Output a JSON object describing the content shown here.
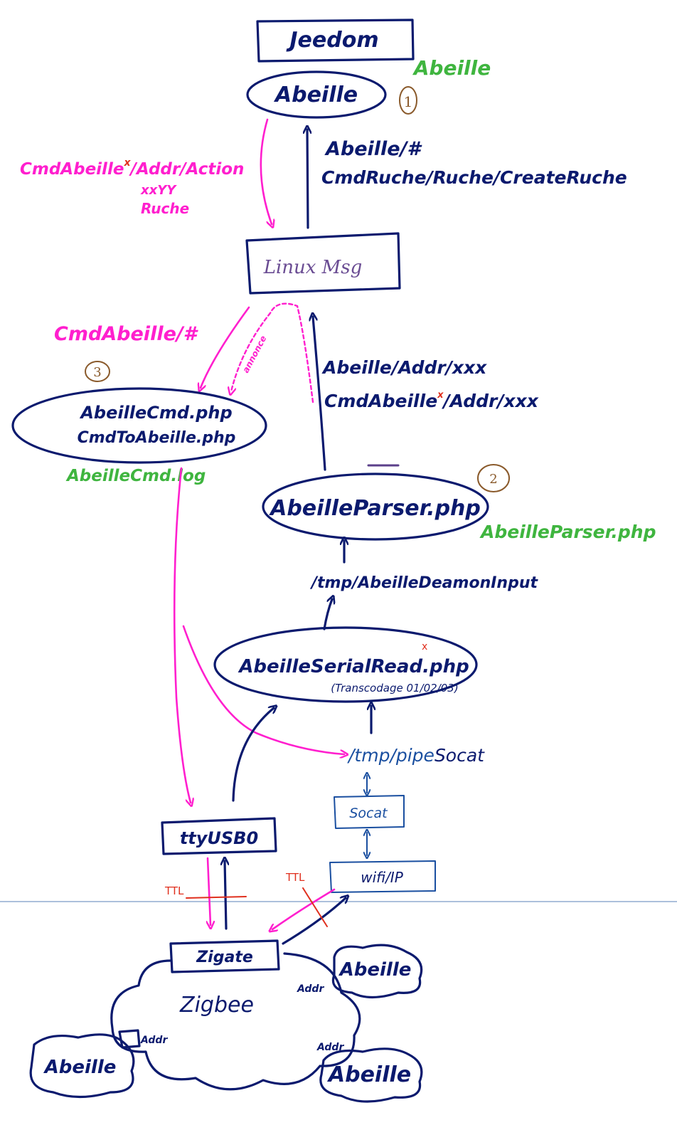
{
  "nodes": {
    "jeedom": "Jeedom",
    "abeille_plugin": "Abeille",
    "linux_msg": "Linux Msg",
    "abeille_cmd_line1": "AbeilleCmd.php",
    "abeille_cmd_line2": "CmdToAbeille.php",
    "abeille_parser": "AbeilleParser.php",
    "serial_read_line1": "AbeilleSerialRead.php",
    "serial_read_line2": "(Transcodage 01/02/03)",
    "tty": "ttyUSB0",
    "socat": "Socat",
    "wifi": "wifi/IP",
    "zigate": "Zigate",
    "zigbee": "Zigbee",
    "device_right_top": "Abeille",
    "device_right_bottom": "Abeille",
    "device_left_bottom": "Abeille"
  },
  "labels": {
    "green_abeille": "Abeille",
    "green_abeille_cmd": "AbeilleCmd.log",
    "green_parser": "AbeilleParser.php",
    "num1": "1",
    "num2": "2",
    "num3": "3",
    "up_msg_line1": "Abeille/#",
    "up_msg_line2": "CmdRuche/Ruche/CreateRuche",
    "pink_cmd_line1": "CmdAbeille",
    "pink_cmd_line1b": "/Addr/Action",
    "pink_cmd_line2": "xxYY",
    "pink_cmd_line3": "Ruche",
    "pink_cmd2": "CmdAbeille/#",
    "pink_dashed": "annonce",
    "parser_out_line1": "Abeille/Addr/xxx",
    "parser_out_line2a": "CmdAbeille",
    "parser_out_line2b": "/Addr/xxx",
    "tmp_input": "/tmp/AbeilleDeamonInput",
    "tmp_pipe_a": "/tmp/pipe",
    "tmp_pipe_b": "Socat",
    "ttl_left": "TTL",
    "ttl_right": "TTL",
    "addr_1": "Addr",
    "addr_2": "Addr",
    "addr_3": "Addr",
    "asterisk_1": "x",
    "asterisk_2": "x",
    "asterisk_3": "x"
  },
  "colors": {
    "ink": "#0b1a6e",
    "pink": "#ff1fce",
    "green": "#3fb53f",
    "blue": "#1a4fa0",
    "red": "#e0301e",
    "brown": "#8a5a2b"
  }
}
